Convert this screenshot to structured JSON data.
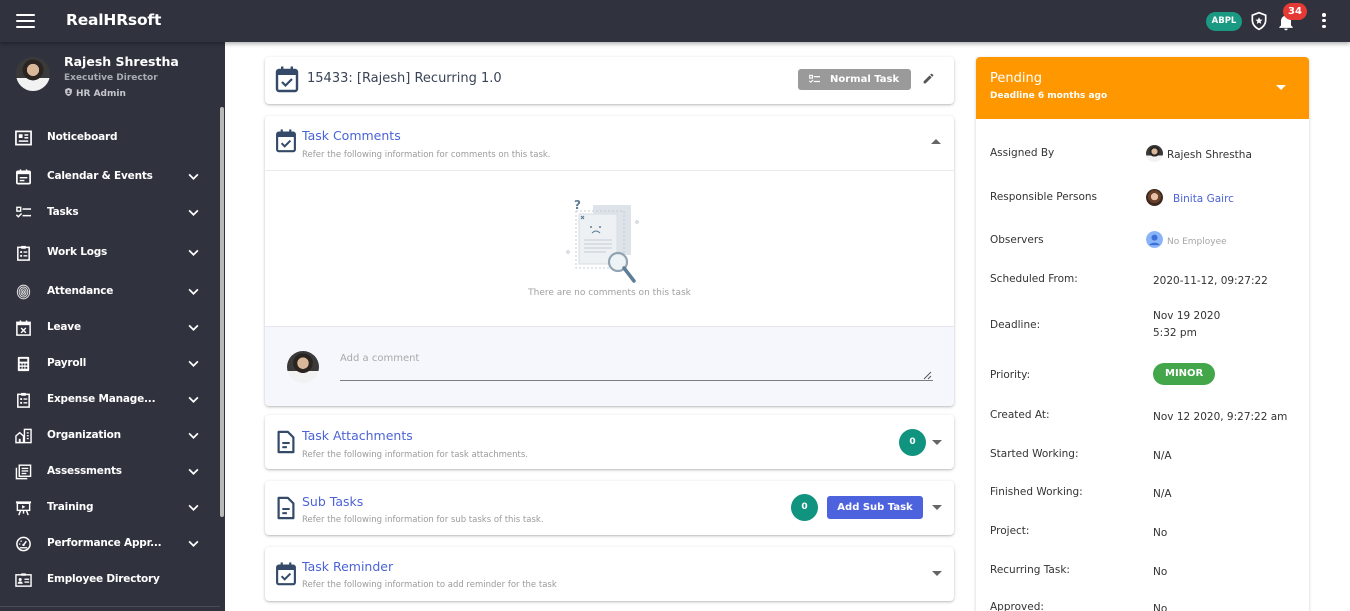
{
  "app": {
    "brand": "RealHRsoft",
    "org_badge": "ABPL",
    "notification_count": "34"
  },
  "profile": {
    "name": "Rajesh Shrestha",
    "role": "Executive Director",
    "access": "HR Admin"
  },
  "sidebar": {
    "items": [
      {
        "label": "Noticeboard",
        "icon": "noticeboard-icon",
        "expandable": false
      },
      {
        "label": "Calendar & Events",
        "icon": "calendar-icon",
        "expandable": true
      },
      {
        "label": "Tasks",
        "icon": "checklist-icon",
        "expandable": true
      },
      {
        "label": "Work Logs",
        "icon": "clipboard-icon",
        "expandable": true
      },
      {
        "label": "Attendance",
        "icon": "fingerprint-icon",
        "expandable": true
      },
      {
        "label": "Leave",
        "icon": "calendar-x-icon",
        "expandable": true
      },
      {
        "label": "Payroll",
        "icon": "calculator-icon",
        "expandable": true
      },
      {
        "label": "Expense Manage...",
        "icon": "clipboard-list-icon",
        "expandable": true
      },
      {
        "label": "Organization",
        "icon": "building-icon",
        "expandable": true
      },
      {
        "label": "Assessments",
        "icon": "documents-icon",
        "expandable": true
      },
      {
        "label": "Training",
        "icon": "presentation-icon",
        "expandable": true
      },
      {
        "label": "Performance Appr...",
        "icon": "speedometer-icon",
        "expandable": true
      },
      {
        "label": "Employee Directory",
        "icon": "id-card-icon",
        "expandable": false
      }
    ]
  },
  "task": {
    "title": "15433: [Rajesh] Recurring 1.0",
    "type_label": "Normal Task"
  },
  "sections": {
    "comments": {
      "title": "Task Comments",
      "subtitle": "Refer the following information for comments on this task.",
      "empty_text": "There are no comments on this task",
      "input_placeholder": "Add a comment",
      "input_value": ""
    },
    "attachments": {
      "title": "Task Attachments",
      "subtitle": "Refer the following information for task attachments.",
      "count": "0"
    },
    "subtasks": {
      "title": "Sub Tasks",
      "subtitle": "Refer the following information for sub tasks of this task.",
      "count": "0",
      "add_label": "Add Sub Task"
    },
    "reminder": {
      "title": "Task Reminder",
      "subtitle": "Refer the following information to add reminder for the task"
    }
  },
  "status": {
    "label": "Pending",
    "deadline_text": "Deadline 6 months ago",
    "color": "#fe9700"
  },
  "details": {
    "assigned_by": {
      "label": "Assigned By",
      "value": "Rajesh Shrestha"
    },
    "responsible": {
      "label": "Responsible Persons",
      "value": "Binita Gairc"
    },
    "observers": {
      "label": "Observers",
      "value": "No Employee"
    },
    "scheduled_from": {
      "label": "Scheduled From:",
      "value": "2020-11-12, 09:27:22"
    },
    "deadline": {
      "label": "Deadline:",
      "value_date": "Nov 19 2020",
      "value_time": "5:32 pm"
    },
    "priority": {
      "label": "Priority:",
      "value": "MINOR",
      "color": "#43a64a"
    },
    "created_at": {
      "label": "Created At:",
      "value": "Nov 12 2020, 9:27:22 am"
    },
    "started_working": {
      "label": "Started Working:",
      "value": "N/A"
    },
    "finished_working": {
      "label": "Finished Working:",
      "value": "N/A"
    },
    "project": {
      "label": "Project:",
      "value": "No"
    },
    "recurring_task": {
      "label": "Recurring Task:",
      "value": "No"
    },
    "approved": {
      "label": "Approved:",
      "value": "No"
    }
  }
}
